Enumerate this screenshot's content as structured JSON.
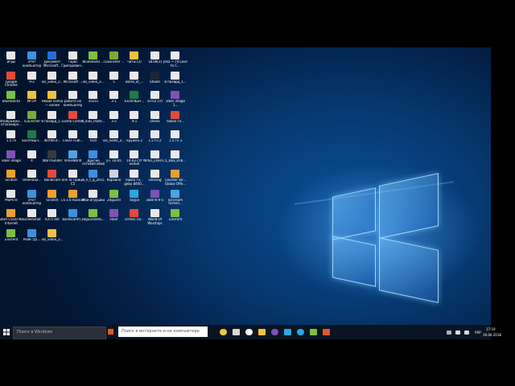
{
  "taskbar": {
    "search_placeholder": "Поиск в Windows",
    "search2_placeholder": "Поиск в интернете и на компьютере",
    "lang": "УКР",
    "time": "17:19",
    "date": "16.04.2018"
  },
  "icons": [
    {
      "label": "игры",
      "color": "#e8e8e8"
    },
    {
      "label": "Этот компьютер",
      "color": "#3d8fe0"
    },
    {
      "label": "Документ Microsoft...",
      "color": "#2b6cd4"
    },
    {
      "label": "Тарас Григорович...",
      "color": "#e6e6e6"
    },
    {
      "label": "BlueStacks ...",
      "color": "#7bc043"
    },
    {
      "label": "TLauncher ...",
      "color": "#7aa83a"
    },
    {
      "label": "читы (2)",
      "color": "#f0c040"
    },
    {
      "label": "18.08(1)",
      "color": "#e8e8e8"
    },
    {
      "label": "Jeka ~ I'd Love to C...",
      "color": "#e8e8e8"
    },
    {
      "label": "Google Chrome",
      "color": "#e04b3c"
    },
    {
      "label": "9-2",
      "color": "#e8e8e8"
    },
    {
      "label": "ios_video_2...",
      "color": "#e8e8e8"
    },
    {
      "label": "Microsoft ...",
      "color": "#e8e8e8"
    },
    {
      "label": "ios_video_2...",
      "color": "#e8e8e8"
    },
    {
      "label": "5",
      "color": "#e8e8e8"
    },
    {
      "label": "world_of_...",
      "color": "#e8e8e8"
    },
    {
      "label": "Steam",
      "color": "#1b2838"
    },
    {
      "label": "8 похврд_1...",
      "color": "#e8e8e8"
    },
    {
      "label": "BlueStacks",
      "color": "#7bc043"
    },
    {
      "label": "ИГОР",
      "color": "#f0c040"
    },
    {
      "label": "Новая папка — копия",
      "color": "#f0c040"
    },
    {
      "label": "робота на компьютер",
      "color": "#e8e8e8"
    },
    {
      "label": "5021s",
      "color": "#e8e8e8"
    },
    {
      "label": "3-1",
      "color": "#e8e8e8"
    },
    {
      "label": "Excel'Вшч...",
      "color": "#1e7b45"
    },
    {
      "label": "10-03 сзт",
      "color": "#e8e8e8"
    },
    {
      "label": "viber image 1...",
      "color": "#7d52b4"
    },
    {
      "label": "Изображен... отсканиро...",
      "color": "#e8e8e8"
    },
    {
      "label": "TLauncher",
      "color": "#7aa83a"
    },
    {
      "label": "8 похврд_1...",
      "color": "#e8e8e8"
    },
    {
      "label": "Game Center",
      "color": "#e04b3c"
    },
    {
      "label": "5_klas_mate...",
      "color": "#e8e8e8"
    },
    {
      "label": "3-2",
      "color": "#e8e8e8"
    },
    {
      "label": "4-1",
      "color": "#e8e8e8"
    },
    {
      "label": "опенк",
      "color": "#e8e8e8"
    },
    {
      "label": "поиск гн...",
      "color": "#e04b3c"
    },
    {
      "label": "1.5 гн",
      "color": "#e8e8e8"
    },
    {
      "label": "Excel'Вшч...",
      "color": "#1e7b45"
    },
    {
      "label": "dkrfdd.d...",
      "color": "#e8e8e8"
    },
    {
      "label": "CSGO-r.LBl...",
      "color": "#e8e8e8"
    },
    {
      "label": "H10",
      "color": "#e8e8e8"
    },
    {
      "label": "ios_video_2...",
      "color": "#e8e8e8"
    },
    {
      "label": "кружка 2",
      "color": "#e8e8e8"
    },
    {
      "label": "1.5 гн 2",
      "color": "#e8e8e8"
    },
    {
      "label": "1.5 гн 3",
      "color": "#e8e8e8"
    },
    {
      "label": "viber image",
      "color": "#7d52b4"
    },
    {
      "label": "4",
      "color": "#e8e8e8"
    },
    {
      "label": "WarThunder",
      "color": "#3a3a3a"
    },
    {
      "label": "VimeWorld",
      "color": "#4fa3e0"
    },
    {
      "label": "Другие сетевой вбой",
      "color": "#3d8fe0"
    },
    {
      "label": "уч. 10-05",
      "color": "#e8e8e8"
    },
    {
      "label": "10-03 сзт копия",
      "color": "#e8e8e8"
    },
    {
      "label": "NPSU_Chern...",
      "color": "#e8e8e8"
    },
    {
      "label": "5_klas_krib...",
      "color": "#e8e8e8"
    },
    {
      "label": "Scratch",
      "color": "#f0a030"
    },
    {
      "label": "OmenaSa...",
      "color": "#e8e8e8"
    },
    {
      "label": "Bandicam",
      "color": "#e04b3c"
    },
    {
      "label": "Unn Sr Прице С5",
      "color": "#e8e8e8"
    },
    {
      "label": "5_n_t_q_2015",
      "color": "#3d8fe0"
    },
    {
      "label": "Корзина",
      "color": "#c9d4e0"
    },
    {
      "label": "поиск гн... gebo 8400...",
      "color": "#e8e8e8"
    },
    {
      "label": "coloring",
      "color": "#e8e8e8"
    },
    {
      "label": "Counter Str... Global Offe...",
      "color": "#e8a030"
    },
    {
      "label": "MaPe III",
      "color": "#e8e8e8"
    },
    {
      "label": "Этот компьютер",
      "color": "#3d8fe0"
    },
    {
      "label": "Scratch",
      "color": "#f0a030"
    },
    {
      "label": "CS 1.6 Russian",
      "color": "#e8a030"
    },
    {
      "label": "Мои игрушки",
      "color": "#e8e8e8"
    },
    {
      "label": "2dguard",
      "color": "#7bc043"
    },
    {
      "label": "Skype",
      "color": "#2aa7e0"
    },
    {
      "label": "viber-6-9-5",
      "color": "#7d52b4"
    },
    {
      "label": "Icecream Screen...",
      "color": "#4fa3e0"
    },
    {
      "label": "Start CSGO No Internet",
      "color": "#e8a030"
    },
    {
      "label": "Screenshot",
      "color": "#e8e8e8"
    },
    {
      "label": "Kirl's Hilt",
      "color": "#e8e8e8"
    },
    {
      "label": "bandicamfl...",
      "color": "#3d8fe0"
    },
    {
      "label": "zdguardsetu...",
      "color": "#7bc043"
    },
    {
      "label": "Viber",
      "color": "#7d52b4"
    },
    {
      "label": "screen.rar...",
      "color": "#e04b3c"
    },
    {
      "label": "World Of Warships",
      "color": "#e8e8e8"
    },
    {
      "label": "uTorrent",
      "color": "#7bc043"
    },
    {
      "label": "uTorrent",
      "color": "#7bc043"
    },
    {
      "label": "PixBF.5J5...",
      "color": "#3d8fe0"
    },
    {
      "label": "ios_video_2...",
      "color": "#f0c040"
    }
  ]
}
